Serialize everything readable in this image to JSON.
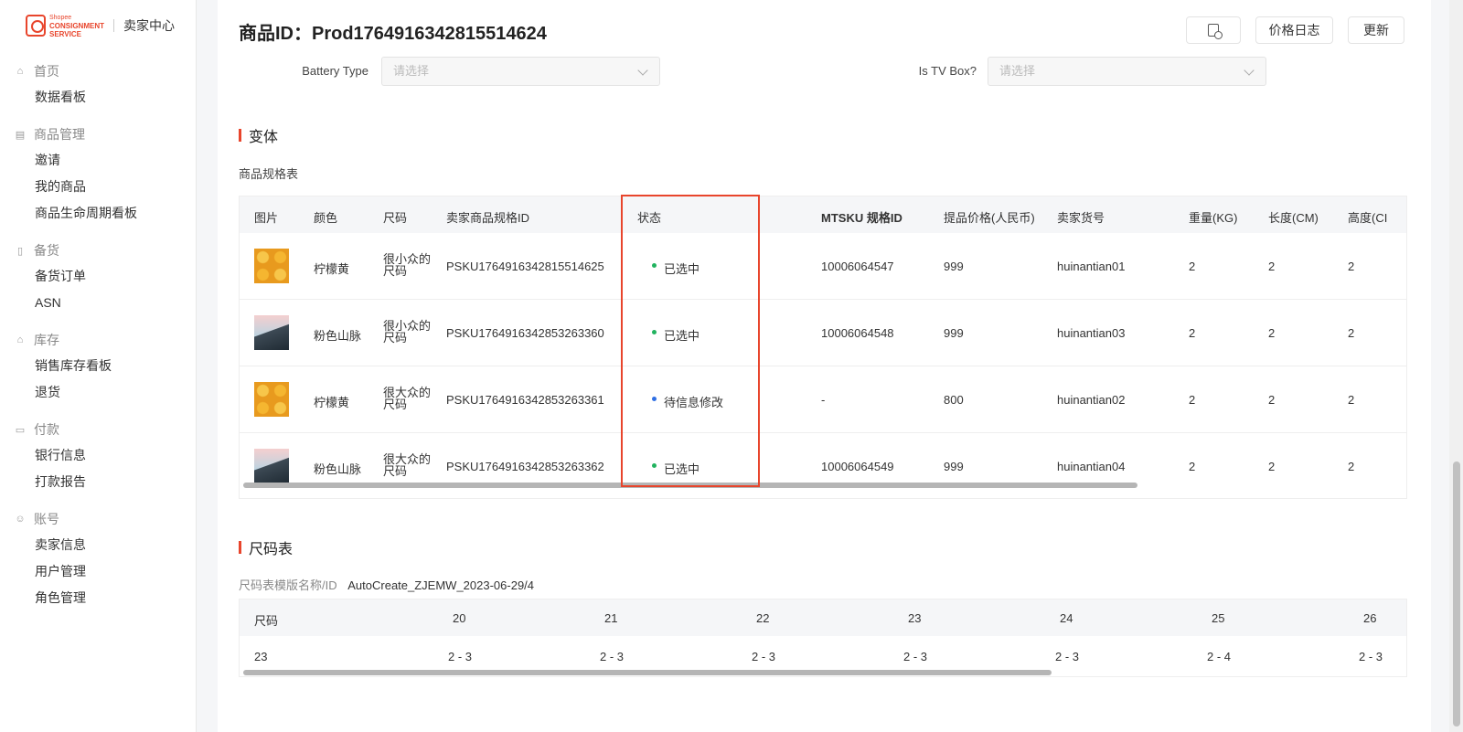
{
  "sidebar": {
    "logo": {
      "small": "Shopee",
      "brand_line1": "CONSIGNMENT",
      "brand_line2": "SERVICE",
      "center": "卖家中心"
    },
    "groups": [
      {
        "title": "首页",
        "icon": "home-icon",
        "items": [
          "数据看板"
        ]
      },
      {
        "title": "商品管理",
        "icon": "box-icon",
        "items": [
          "邀请",
          "我的商品",
          "商品生命周期看板"
        ]
      },
      {
        "title": "备货",
        "icon": "clipboard-icon",
        "items": [
          "备货订单",
          "ASN"
        ]
      },
      {
        "title": "库存",
        "icon": "warehouse-icon",
        "items": [
          "销售库存看板",
          "退货"
        ]
      },
      {
        "title": "付款",
        "icon": "wallet-icon",
        "items": [
          "银行信息",
          "打款报告"
        ]
      },
      {
        "title": "账号",
        "icon": "user-icon",
        "items": [
          "卖家信息",
          "用户管理",
          "角色管理"
        ]
      }
    ]
  },
  "header": {
    "title": "商品ID：Prod1764916342815514624",
    "icon_button": "document-search-icon",
    "price_log": "价格日志",
    "update": "更新"
  },
  "form": {
    "battery_label": "Battery Type",
    "battery_placeholder": "请选择",
    "tvbox_label": "Is TV Box?",
    "tvbox_placeholder": "请选择"
  },
  "variants": {
    "section_title": "变体",
    "table_label": "商品规格表",
    "columns": [
      "图片",
      "颜色",
      "尺码",
      "卖家商品规格ID",
      "状态",
      "MTSKU 规格ID",
      "提品价格(人民币)",
      "卖家货号",
      "重量(KG)",
      "长度(CM)",
      "高度(CI"
    ],
    "rows": [
      {
        "image": "lemon",
        "color": "柠檬黄",
        "size": "很小众的尺码",
        "sku": "PSKU1764916342815514625",
        "status": "已选中",
        "status_color": "#21b35f",
        "mtsku": "10006064547",
        "price": "999",
        "seller_no": "huinantian01",
        "weight": "2",
        "length": "2",
        "height": "2"
      },
      {
        "image": "mountain",
        "color": "粉色山脉",
        "size": "很小众的尺码",
        "sku": "PSKU1764916342853263360",
        "status": "已选中",
        "status_color": "#21b35f",
        "mtsku": "10006064548",
        "price": "999",
        "seller_no": "huinantian03",
        "weight": "2",
        "length": "2",
        "height": "2"
      },
      {
        "image": "lemon",
        "color": "柠檬黄",
        "size": "很大众的尺码",
        "sku": "PSKU1764916342853263361",
        "status": "待信息修改",
        "status_color": "#2f6fe4",
        "mtsku": "-",
        "price": "800",
        "seller_no": "huinantian02",
        "weight": "2",
        "length": "2",
        "height": "2"
      },
      {
        "image": "mountain",
        "color": "粉色山脉",
        "size": "很大众的尺码",
        "sku": "PSKU1764916342853263362",
        "status": "已选中",
        "status_color": "#21b35f",
        "mtsku": "10006064549",
        "price": "999",
        "seller_no": "huinantian04",
        "weight": "2",
        "length": "2",
        "height": "2"
      }
    ]
  },
  "size_chart": {
    "section_title": "尺码表",
    "template_label": "尺码表模版名称/ID",
    "template_value": "AutoCreate_ZJEMW_2023-06-29/4",
    "header": [
      "尺码",
      "20",
      "21",
      "22",
      "23",
      "24",
      "25",
      "26"
    ],
    "row": [
      "23",
      "2 - 3",
      "2 - 3",
      "2 - 3",
      "2 - 3",
      "2 - 3",
      "2 - 4",
      "2 - 3"
    ]
  },
  "colors": {
    "accent": "#e8452c",
    "selected": "#21b35f",
    "pending": "#2f6fe4"
  }
}
